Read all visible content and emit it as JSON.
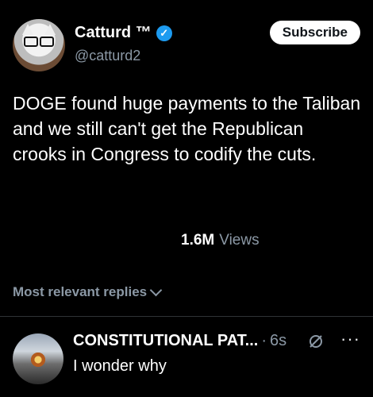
{
  "header": {
    "display_name": "Catturd ™",
    "verified_icon": "verified-badge-icon",
    "handle": "@catturd2",
    "subscribe_label": "Subscribe"
  },
  "tweet": {
    "text": "DOGE found huge payments to the Taliban and we still can't get the Republican crooks in Congress to codify the cuts.",
    "views_count": "1.6M",
    "views_label": "Views"
  },
  "replies": {
    "filter_label": "Most relevant replies",
    "items": [
      {
        "name": "CONSTITUTIONAL PAT...",
        "dot": "·",
        "time": "6s",
        "text": "I wonder why"
      }
    ]
  },
  "colors": {
    "background": "#000000",
    "text": "#e7e9ea",
    "muted": "#8b98a5",
    "accent": "#1d9bf0",
    "button_bg": "#ffffff"
  }
}
